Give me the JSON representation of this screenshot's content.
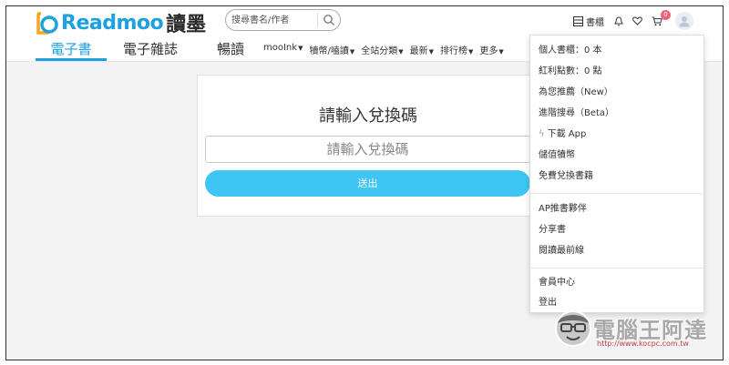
{
  "brand": {
    "name_prefix": "Read",
    "name_suffix": "moo",
    "name_cn": "讀墨",
    "accent_color": "#1da1e0"
  },
  "search": {
    "placeholder": "搜尋書名/作者",
    "icon": "search-icon"
  },
  "header_tools": {
    "shelf_label": "書櫃",
    "shelf_icon": "bookshelf-icon",
    "notification_icon": "bell-icon",
    "wishlist_icon": "heart-icon",
    "cart_icon": "cart-icon",
    "cart_count": "0",
    "avatar_icon": "user-avatar-icon"
  },
  "nav": {
    "tabs": [
      {
        "label": "電子書",
        "active": true
      },
      {
        "label": "電子雜誌",
        "active": false
      },
      {
        "label": "暢讀",
        "active": false
      }
    ]
  },
  "menu": {
    "items": [
      {
        "label": "mooInk"
      },
      {
        "label": "犢幣/嗑讀"
      },
      {
        "label": "全站分類"
      },
      {
        "label": "最新"
      },
      {
        "label": "排行榜"
      },
      {
        "label": "更多"
      }
    ]
  },
  "redeem": {
    "title": "請輸入兌換碼",
    "input_placeholder": "請輸入兌換碼",
    "submit_label": "送出",
    "button_color": "#3ec5f3"
  },
  "user_menu": {
    "group1": [
      {
        "label": "個人書櫃：0 本"
      },
      {
        "label": "紅利點數：0 點"
      },
      {
        "label": "為您推薦（New）"
      },
      {
        "label": "進階搜尋（Beta）"
      },
      {
        "label": "下載 App"
      },
      {
        "label": "儲值犢幣"
      },
      {
        "label": "免費兌換書籍"
      }
    ],
    "group2": [
      {
        "label": "AP推書夥伴"
      },
      {
        "label": "分享書"
      },
      {
        "label": "閱讀最前線"
      }
    ],
    "group3": [
      {
        "label": "會員中心"
      },
      {
        "label": "登出"
      }
    ]
  },
  "watermark": {
    "title": "電腦王阿達",
    "url": "http://www.kocpc.com.tw"
  }
}
